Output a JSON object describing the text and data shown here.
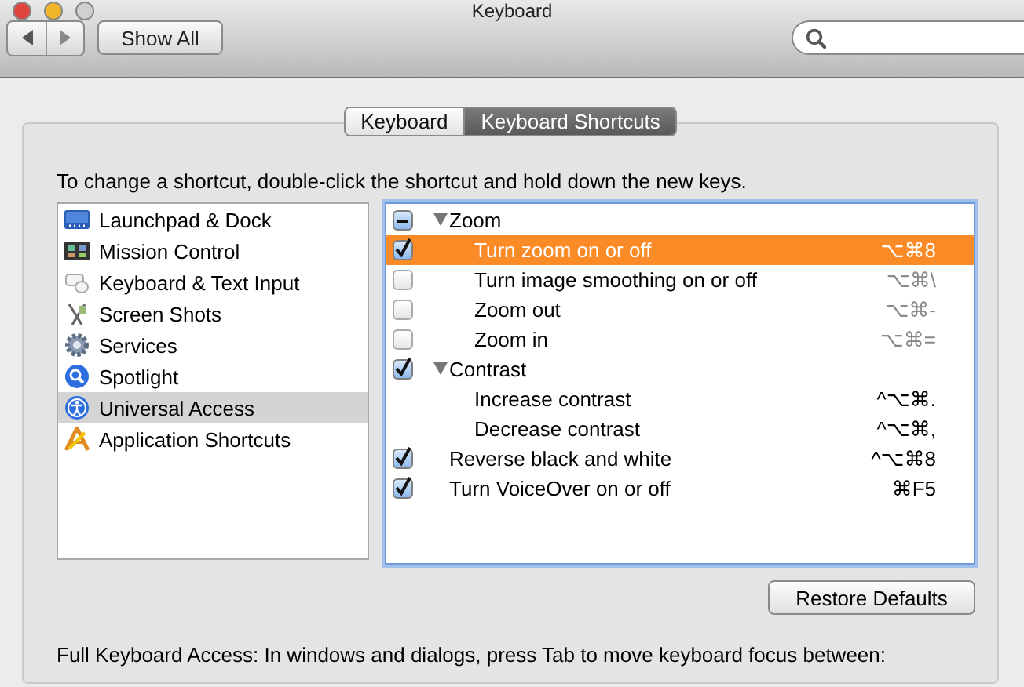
{
  "window": {
    "title": "Keyboard"
  },
  "toolbar": {
    "show_all": "Show All"
  },
  "tabs": [
    {
      "label": "Keyboard",
      "selected": false
    },
    {
      "label": "Keyboard Shortcuts",
      "selected": true
    }
  ],
  "instructions": "To change a shortcut, double-click the shortcut and hold down the new keys.",
  "categories": [
    {
      "label": "Launchpad & Dock",
      "selected": false
    },
    {
      "label": "Mission Control",
      "selected": false
    },
    {
      "label": "Keyboard & Text Input",
      "selected": false
    },
    {
      "label": "Screen Shots",
      "selected": false
    },
    {
      "label": "Services",
      "selected": false
    },
    {
      "label": "Spotlight",
      "selected": false
    },
    {
      "label": "Universal Access",
      "selected": true
    },
    {
      "label": "Application Shortcuts",
      "selected": false
    }
  ],
  "shortcuts": [
    {
      "kind": "checkbox",
      "label": "Zoom",
      "checked": true,
      "mixed": true,
      "expanded": true,
      "selected": false,
      "children": [
        {
          "kind": "checkbox",
          "label": "Turn zoom on or off",
          "checked": true,
          "selected": true,
          "keys": "⌥⌘8"
        },
        {
          "kind": "checkbox",
          "label": "Turn image smoothing on or off",
          "checked": false,
          "selected": false,
          "keys": "⌥⌘\\"
        },
        {
          "kind": "checkbox",
          "label": "Zoom out",
          "checked": false,
          "selected": false,
          "keys": "⌥⌘-"
        },
        {
          "kind": "checkbox",
          "label": "Zoom in",
          "checked": false,
          "selected": false,
          "keys": "⌥⌘="
        }
      ]
    },
    {
      "kind": "checkbox",
      "label": "Contrast",
      "checked": true,
      "expanded": true,
      "selected": false,
      "children": [
        {
          "kind": "plain",
          "label": "Increase contrast",
          "selected": false,
          "keys": "^⌥⌘."
        },
        {
          "kind": "plain",
          "label": "Decrease contrast",
          "selected": false,
          "keys": "^⌥⌘,"
        }
      ]
    },
    {
      "kind": "checkbox",
      "label": "Reverse black and white",
      "checked": true,
      "selected": false,
      "keys": "^⌥⌘8"
    },
    {
      "kind": "checkbox",
      "label": "Turn VoiceOver on or off",
      "checked": true,
      "selected": false,
      "keys": "⌘F5"
    }
  ],
  "restore_button": "Restore Defaults",
  "footer_text": "Full Keyboard Access: In windows and dialogs, press Tab to move keyboard focus between:"
}
